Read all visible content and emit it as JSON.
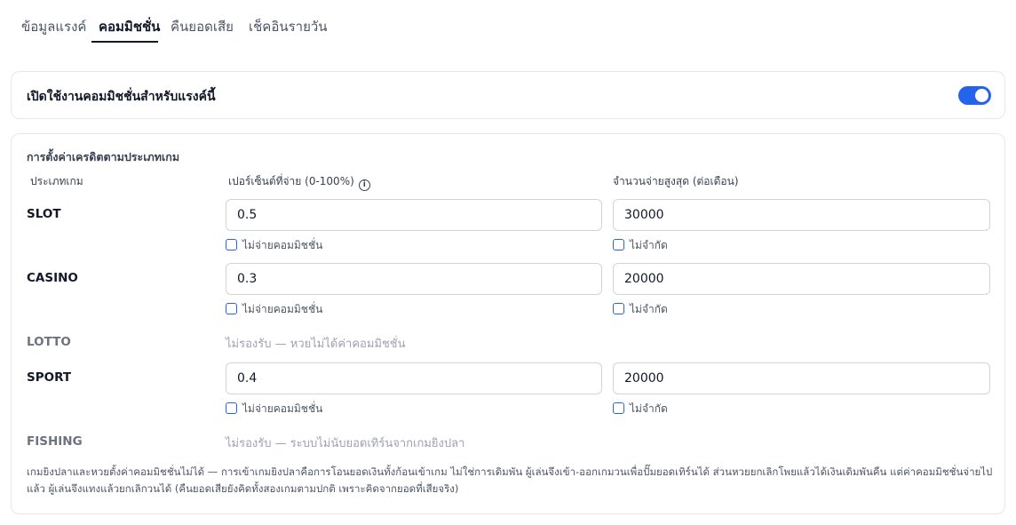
{
  "tabs": [
    {
      "label": "ข้อมูลแรงค์",
      "active": false
    },
    {
      "label": "คอมมิชชั่น",
      "active": true
    },
    {
      "label": "คืนยอดเสีย",
      "active": false
    },
    {
      "label": "เช็คอินรายวัน",
      "active": false
    }
  ],
  "enable": {
    "label": "เปิดใช้งานคอมมิชชั่นสำหรับแรงค์นี้",
    "enabled": true
  },
  "settings": {
    "title": "การตั้งค่าเครดิตตามประเภทเกม",
    "col_type": "ประเภทเกม",
    "col_percent": "เปอร์เซ็นต์ที่จ่าย (0-100%)",
    "col_max": "จำนวนจ่ายสูงสุด (ต่อเดือน)",
    "rows": [
      {
        "name": "SLOT",
        "percent": "0.5",
        "max": "30000",
        "no_pay_label": "ไม่จ่ายคอมมิชชั่น",
        "unlimited_label": "ไม่จำกัด"
      },
      {
        "name": "CASINO",
        "percent": "0.3",
        "max": "20000",
        "no_pay_label": "ไม่จ่ายคอมมิชชั่น",
        "unlimited_label": "ไม่จำกัด"
      },
      {
        "name": "LOTTO",
        "unsupported": "ไม่รองรับ — หวยไม่ได้ค่าคอมมิชชั่น"
      },
      {
        "name": "SPORT",
        "percent": "0.4",
        "max": "20000",
        "no_pay_label": "ไม่จ่ายคอมมิชชั่น",
        "unlimited_label": "ไม่จำกัด"
      },
      {
        "name": "FISHING",
        "unsupported": "ไม่รองรับ — ระบบไม่นับยอดเทิร์นจากเกมยิงปลา"
      }
    ],
    "footnote": "เกมยิงปลาและหวยตั้งค่าคอมมิชชั่นไม่ได้ — การเข้าเกมยิงปลาคือการโอนยอดเงินทั้งก้อนเข้าเกม ไม่ใช่การเดิมพัน ผู้เล่นจึงเข้า-ออกเกมวนเพื่อปั๊มยอดเทิร์นได้ ส่วนหวยยกเลิกโพยแล้วได้เงินเดิมพันคืน แต่ค่าคอมมิชชั่นจ่ายไปแล้ว ผู้เล่นจึงแทงแล้วยกเลิกวนได้ (คืนยอดเสียยังคิดทั้งสองเกมตามปกติ เพราะคิดจากยอดที่เสียจริง)"
  },
  "colors": {
    "accent": "#2563eb",
    "border": "#e5e7eb",
    "muted": "#9ca3af"
  },
  "icons": {
    "info": "info-circle-icon",
    "checkbox": "checkbox-icon"
  }
}
